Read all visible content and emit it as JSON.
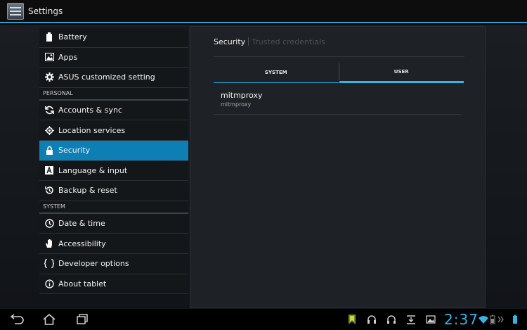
{
  "app": {
    "title": "Settings"
  },
  "left_list": [
    {
      "kind": "item",
      "name": "sidebar-item-battery",
      "icon": "battery-icon",
      "label": "Battery"
    },
    {
      "kind": "item",
      "name": "sidebar-item-apps",
      "icon": "apps-icon",
      "label": "Apps"
    },
    {
      "kind": "item",
      "name": "sidebar-item-asus",
      "icon": "gear-icon",
      "label": "ASUS customized setting"
    },
    {
      "kind": "header",
      "label": "PERSONAL"
    },
    {
      "kind": "item",
      "name": "sidebar-item-accounts",
      "icon": "sync-icon",
      "label": "Accounts & sync"
    },
    {
      "kind": "item",
      "name": "sidebar-item-location",
      "icon": "location-icon",
      "label": "Location services"
    },
    {
      "kind": "item",
      "name": "sidebar-item-security",
      "icon": "lock-icon",
      "label": "Security",
      "selected": true
    },
    {
      "kind": "item",
      "name": "sidebar-item-language",
      "icon": "language-icon",
      "label": "Language & input"
    },
    {
      "kind": "item",
      "name": "sidebar-item-backup",
      "icon": "backup-icon",
      "label": "Backup & reset"
    },
    {
      "kind": "header",
      "label": "SYSTEM"
    },
    {
      "kind": "item",
      "name": "sidebar-item-datetime",
      "icon": "clock-icon",
      "label": "Date & time"
    },
    {
      "kind": "item",
      "name": "sidebar-item-accessibility",
      "icon": "hand-icon",
      "label": "Accessibility"
    },
    {
      "kind": "item",
      "name": "sidebar-item-developer",
      "icon": "braces-icon",
      "label": "Developer options"
    },
    {
      "kind": "item",
      "name": "sidebar-item-about",
      "icon": "info-icon",
      "label": "About tablet"
    }
  ],
  "breadcrumb": {
    "current": "Security",
    "next": "Trusted credentials"
  },
  "tabs": {
    "system": "SYSTEM",
    "user": "USER",
    "active": "USER"
  },
  "credential": {
    "title": "mitmproxy",
    "subtitle": "mitmproxy"
  },
  "status": {
    "time": "2:37"
  },
  "colors": {
    "accent": "#33b5e5",
    "selected": "#0e7fb5"
  }
}
